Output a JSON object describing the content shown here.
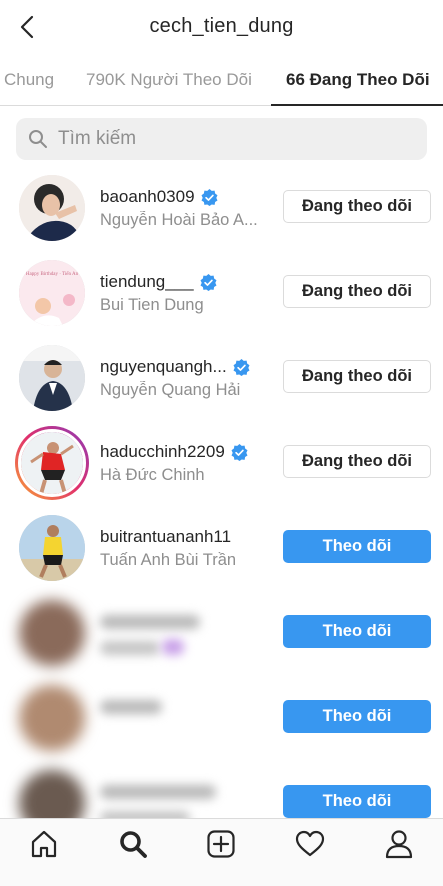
{
  "header": {
    "title": "cech_tien_dung"
  },
  "tabs": [
    {
      "label": "Chung"
    },
    {
      "label": "790K Người Theo Dõi"
    },
    {
      "label": "66 Đang Theo Dõi"
    }
  ],
  "search": {
    "placeholder": "Tìm kiếm"
  },
  "rows": [
    {
      "username": "baoanh0309",
      "fullname": "Nguyễn Hoài Bảo A...",
      "verified": true,
      "button": "Đang theo dõi"
    },
    {
      "username": "tiendung___",
      "fullname": "Bui Tien Dung",
      "verified": true,
      "button": "Đang theo dõi",
      "avatar_text": "Happy Birthday · Tiến An"
    },
    {
      "username": "nguyenquangh...",
      "fullname": "Nguyễn Quang Hải",
      "verified": true,
      "button": "Đang theo dõi"
    },
    {
      "username": "haducchinh2209",
      "fullname": "Hà Đức Chinh",
      "verified": true,
      "button": "Đang theo dõi"
    },
    {
      "username": "buitrantuananh11",
      "fullname": "Tuấn Anh Bùi Trần",
      "verified": false,
      "button": "Theo dõi"
    },
    {
      "username": "",
      "fullname": "",
      "button": "Theo dõi"
    },
    {
      "username": "",
      "fullname": "",
      "button": "Theo dõi"
    },
    {
      "username": "",
      "fullname": "",
      "button": "Theo dõi"
    }
  ],
  "colors": {
    "accent": "#3897f0",
    "verified": "#3897f0",
    "secondary_text": "#8e8e8e"
  },
  "bottom_nav": [
    "home-icon",
    "search-icon",
    "add-post-icon",
    "activity-heart-icon",
    "profile-icon"
  ]
}
